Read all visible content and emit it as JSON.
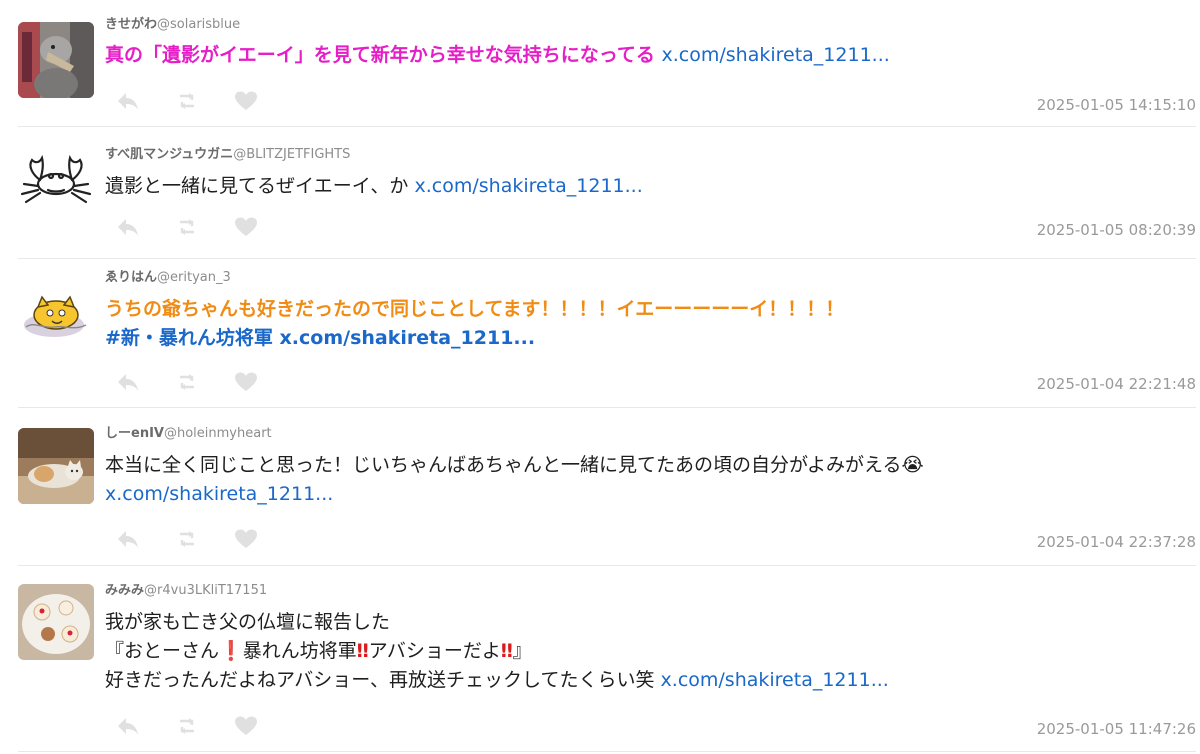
{
  "icons": {
    "reply": "reply-icon",
    "retweet": "retweet-icon",
    "like": "heart-icon"
  },
  "colors": {
    "link": "#1a68c9",
    "magenta": "#e61ec8",
    "orange": "#f08c14",
    "meta": "#8c8c8c",
    "timestamp": "#9a9a9a"
  },
  "tweets": [
    {
      "name": "きせがわ",
      "handle": "@solarisblue",
      "text": "真の「遺影がイエーイ」を見て新年から幸せな気持ちになってる",
      "link": "x.com/shakireta_1211...",
      "timestamp": "2025-01-05 14:15:10"
    },
    {
      "name": "すべ肌マンジュウガニ",
      "handle": "@BLITZJETFIGHTS",
      "text": "遺影と一緒に見てるぜイエーイ、か",
      "link": "x.com/shakireta_1211...",
      "timestamp": "2025-01-05 08:20:39"
    },
    {
      "name": "ゑりはん",
      "handle": "@erityan_3",
      "text": "うちの爺ちゃんも好きだったので同じことしてます！！！！イエーーーーーイ！！！！",
      "hashtag": "#新・暴れん坊将軍",
      "link": "x.com/shakireta_1211...",
      "timestamp": "2025-01-04 22:21:48"
    },
    {
      "name": "しーenIV",
      "handle": "@holeinmyheart",
      "text": "本当に全く同じこと思った！じいちゃんばあちゃんと一緒に見てたあの頃の自分がよみがえる",
      "emoji": "😭",
      "link": "x.com/shakireta_1211...",
      "timestamp": "2025-01-04 22:37:28"
    },
    {
      "name": "みみみ",
      "handle": "@r4vu3LKliT17151",
      "line1": "我が家も亡き父の仏壇に報告した",
      "line2_a": "『おとーさん",
      "line2_ex1": "❗",
      "line2_b": "暴れん坊将軍",
      "line2_ex2": "‼",
      "line2_c": "アバショーだよ",
      "line2_ex3": "‼",
      "line2_d": "』",
      "line3": "好きだったんだよねアバショー、再放送チェックしてたくらい笑",
      "link": "x.com/shakireta_1211...",
      "timestamp": "2025-01-05 11:47:26"
    }
  ]
}
